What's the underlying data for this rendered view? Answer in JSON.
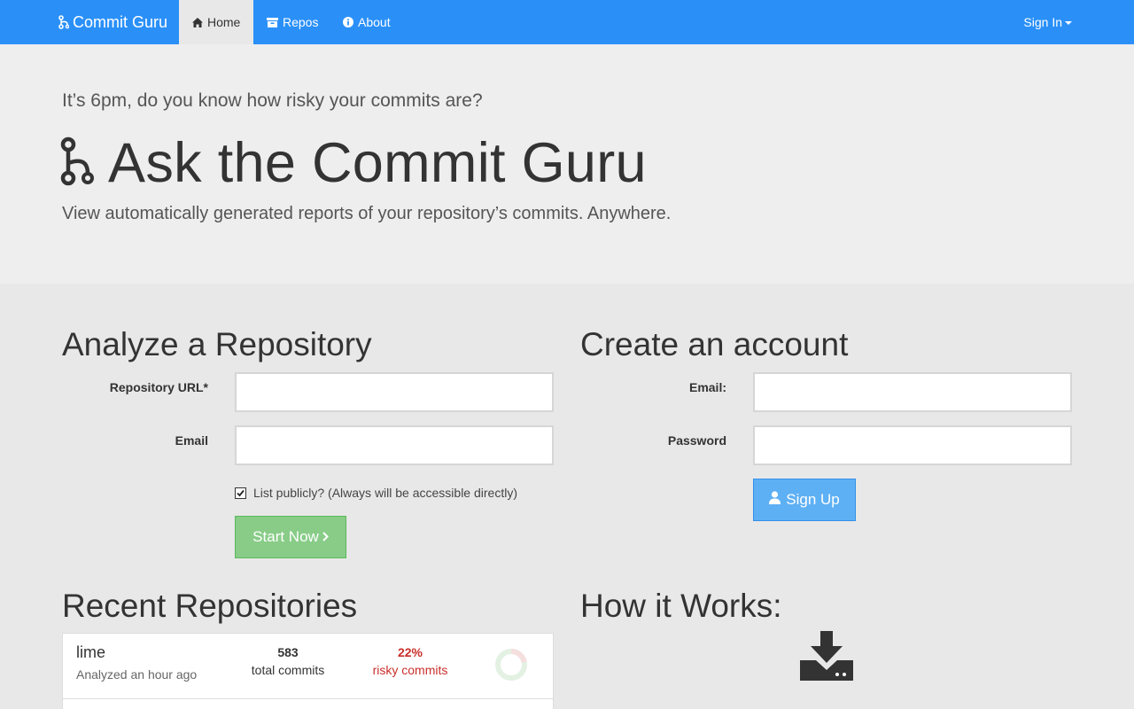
{
  "navbar": {
    "brand": "Commit Guru",
    "tabs": [
      {
        "label": "Home",
        "icon": "home-icon",
        "active": true
      },
      {
        "label": "Repos",
        "icon": "archive-icon",
        "active": false
      },
      {
        "label": "About",
        "icon": "info-icon",
        "active": false
      }
    ],
    "signin_label": "Sign In"
  },
  "hero": {
    "tagline": "It’s 6pm, do you know how risky your commits are?",
    "title": "Ask the Commit Guru",
    "subtitle": "View automatically generated reports of your repository’s commits. Anywhere."
  },
  "analyze": {
    "heading": "Analyze a Repository",
    "repo_url_label": "Repository URL*",
    "repo_url_value": "",
    "email_label": "Email",
    "email_value": "",
    "list_publicly_label": "List publicly? (Always will be accessible directly)",
    "list_publicly_checked": true,
    "start_button": "Start Now"
  },
  "account": {
    "heading": "Create an account",
    "email_label": "Email:",
    "email_value": "",
    "password_label": "Password",
    "password_value": "",
    "signup_button": "Sign Up"
  },
  "recent": {
    "heading": "Recent Repositories",
    "repos": [
      {
        "name": "lime",
        "analyzed": "Analyzed an hour ago",
        "total_commits": "583",
        "total_label": "total commits",
        "risky_pct": "22%",
        "risky_label": "risky commits",
        "risky_fraction": 0.22
      }
    ]
  },
  "how": {
    "heading": "How it Works:",
    "icon": "download-icon"
  },
  "colors": {
    "navbar": "#2a90f8",
    "risky": "#c9302c",
    "start_button": "#88cc88",
    "signup_button": "#5eb0f4"
  }
}
